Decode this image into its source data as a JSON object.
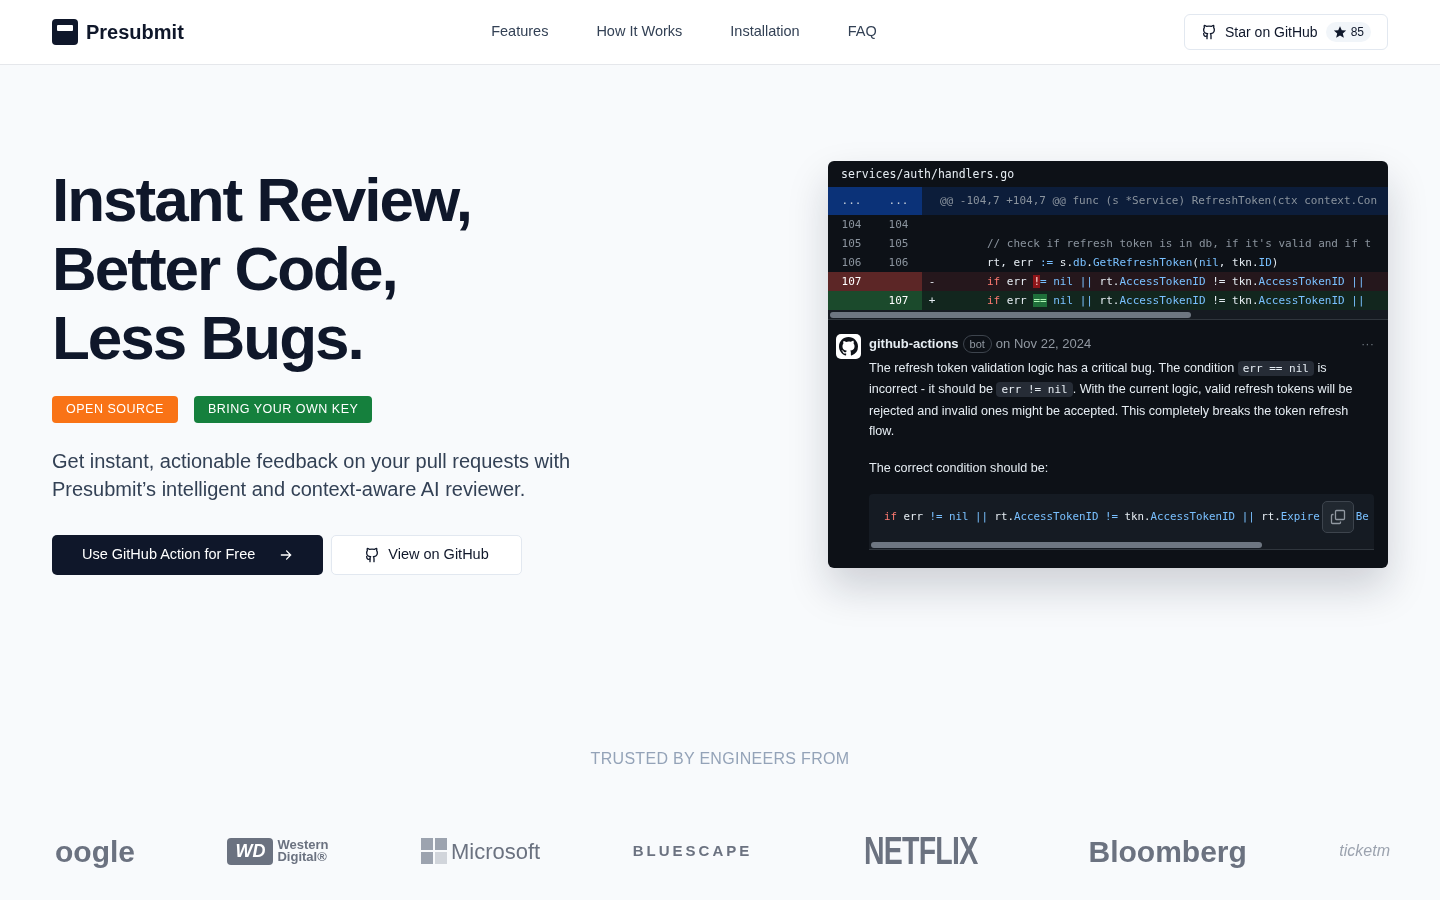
{
  "brand": {
    "name": "Presubmit"
  },
  "nav": [
    {
      "label": "Features"
    },
    {
      "label": "How It Works"
    },
    {
      "label": "Installation"
    },
    {
      "label": "FAQ"
    }
  ],
  "star_button": {
    "label": "Star on GitHub",
    "count": "85"
  },
  "hero": {
    "title_lines": [
      "Instant Review,",
      "Better Code,",
      "Less Bugs."
    ],
    "badges": [
      {
        "label": "OPEN SOURCE",
        "color": "#f97316"
      },
      {
        "label": "BRING YOUR OWN KEY",
        "color": "#15803d"
      }
    ],
    "subtitle": "Get instant, actionable feedback on your pull requests with Presubmit’s intelligent and context-aware AI reviewer.",
    "buttons": [
      {
        "kind": "primary",
        "label": "Use GitHub Action for Free"
      },
      {
        "kind": "secondary",
        "label": "View on GitHub"
      }
    ]
  },
  "review": {
    "file": "services/auth/handlers.go",
    "lines": [
      {
        "kind": "hunk",
        "old": "...",
        "new": "...",
        "tokens": [
          {
            "kind": "comment",
            "text": "@@ -104,7 +104,7 @@ func (s *Service) RefreshToken(ctx context.Con"
          }
        ]
      },
      {
        "kind": "context",
        "old": "104",
        "new": "104"
      },
      {
        "kind": "context",
        "old": "105",
        "new": "105",
        "tokens": [
          {
            "kind": "comment",
            "text": "// check if refresh token is in db, if it's valid and if t"
          }
        ]
      },
      {
        "kind": "context",
        "old": "106",
        "new": "106",
        "tokens": [
          {
            "kind": "plain",
            "text": "rt, err "
          },
          {
            "kind": "accent",
            "text": ":="
          },
          {
            "kind": "plain",
            "text": " s."
          },
          {
            "kind": "accent",
            "text": "db"
          },
          {
            "kind": "plain",
            "text": "."
          },
          {
            "kind": "accent",
            "text": "GetRefreshToken"
          },
          {
            "kind": "plain",
            "text": "("
          },
          {
            "kind": "accent",
            "text": "nil"
          },
          {
            "kind": "plain",
            "text": ", tkn."
          },
          {
            "kind": "accent",
            "text": "ID"
          },
          {
            "kind": "plain",
            "text": ")"
          }
        ]
      },
      {
        "kind": "del",
        "old": "107",
        "sign": "-",
        "tokens": [
          {
            "kind": "keyword",
            "text": "if"
          },
          {
            "kind": "plain",
            "text": " err "
          },
          {
            "kind": "mark",
            "text": "!"
          },
          {
            "kind": "accent",
            "text": "= nil ||"
          },
          {
            "kind": "plain",
            "text": " rt."
          },
          {
            "kind": "accent",
            "text": "AccessTokenID"
          },
          {
            "kind": "plain",
            "text": " != tkn."
          },
          {
            "kind": "accent",
            "text": "AccessTokenID"
          },
          {
            "kind": "accent",
            "text": " ||"
          }
        ]
      },
      {
        "kind": "add",
        "new": "107",
        "sign": "+",
        "tokens": [
          {
            "kind": "keyword",
            "text": "if"
          },
          {
            "kind": "plain",
            "text": " err "
          },
          {
            "kind": "mark",
            "text": "=="
          },
          {
            "kind": "accent",
            "text": " nil ||"
          },
          {
            "kind": "plain",
            "text": " rt."
          },
          {
            "kind": "accent",
            "text": "AccessTokenID"
          },
          {
            "kind": "plain",
            "text": " != tkn."
          },
          {
            "kind": "accent",
            "text": "AccessTokenID"
          },
          {
            "kind": "accent",
            "text": " ||"
          }
        ]
      }
    ],
    "comment": {
      "author": "github-actions",
      "tag": "bot",
      "date": "on Nov 22, 2024",
      "menu": "···",
      "body": [
        {
          "kind": "text",
          "text": "The refresh token validation logic has a critical bug. The condition "
        },
        {
          "kind": "code",
          "text": "err == nil"
        },
        {
          "kind": "text",
          "text": " is incorrect - it should be "
        },
        {
          "kind": "code",
          "text": "err != nil"
        },
        {
          "kind": "text",
          "text": ". With the current logic, valid refresh tokens will be rejected and invalid ones might be accepted. This completely breaks the token refresh flow."
        }
      ],
      "lead": "The correct condition should be:",
      "suggestion": [
        {
          "kind": "keyword",
          "text": "if"
        },
        {
          "kind": "plain",
          "text": " err "
        },
        {
          "kind": "accent",
          "text": "!= nil ||"
        },
        {
          "kind": "plain",
          "text": " rt."
        },
        {
          "kind": "accent",
          "text": "AccessTokenID"
        },
        {
          "kind": "accent",
          "text": " !="
        },
        {
          "kind": "plain",
          "text": " tkn."
        },
        {
          "kind": "accent",
          "text": "AccessTokenID"
        },
        {
          "kind": "accent",
          "text": " ||"
        },
        {
          "kind": "plain",
          "text": " rt."
        },
        {
          "kind": "accent",
          "text": "Expire"
        }
      ],
      "suggestion_tail": "Be"
    }
  },
  "trusted": {
    "heading": "TRUSTED BY ENGINEERS FROM",
    "logos": [
      {
        "kind": "round",
        "text": "oogle"
      },
      {
        "kind": "wd",
        "badge": "WD",
        "text": "Western",
        "text2": "Digital®"
      },
      {
        "kind": "microsoft",
        "text": "Microsoft"
      },
      {
        "kind": "spaced",
        "text": "BLUESCAPE"
      },
      {
        "kind": "condensed",
        "text": "NETFLIX"
      },
      {
        "kind": "round",
        "text": "Bloomberg"
      },
      {
        "kind": "faded",
        "text": "ticketm"
      }
    ]
  }
}
